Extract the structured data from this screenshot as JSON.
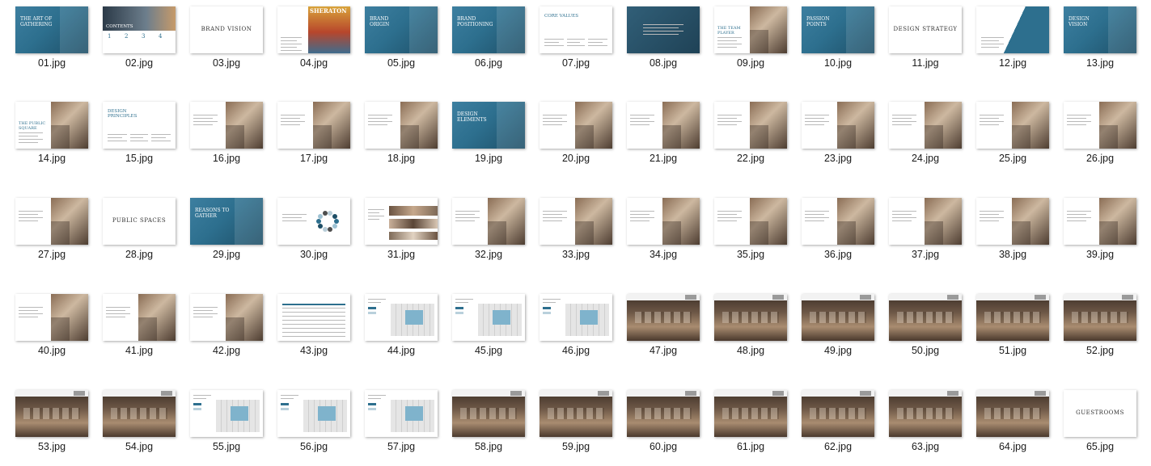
{
  "files": [
    {
      "name": "01.jpg",
      "style": "blue-img",
      "text": "THE ART OF GATHERING"
    },
    {
      "name": "02.jpg",
      "style": "contents",
      "text": "CONTENTS"
    },
    {
      "name": "03.jpg",
      "style": "title-white",
      "text": "BRAND VISION"
    },
    {
      "name": "04.jpg",
      "style": "sheraton",
      "text": "SHERATON"
    },
    {
      "name": "05.jpg",
      "style": "blue-img",
      "text": "BRAND ORIGIN"
    },
    {
      "name": "06.jpg",
      "style": "blue-img",
      "text": "BRAND POSITIONING"
    },
    {
      "name": "07.jpg",
      "style": "white-text",
      "text": "CORE VALUES"
    },
    {
      "name": "08.jpg",
      "style": "blue-dark",
      "text": ""
    },
    {
      "name": "09.jpg",
      "style": "text-photo",
      "text": "THE TEAM PLAYER"
    },
    {
      "name": "10.jpg",
      "style": "blue-img",
      "text": "PASSION POINTS"
    },
    {
      "name": "11.jpg",
      "style": "title-white",
      "text": "DESIGN STRATEGY"
    },
    {
      "name": "12.jpg",
      "style": "white-wedge",
      "text": ""
    },
    {
      "name": "13.jpg",
      "style": "blue-img",
      "text": "DESIGN VISION"
    },
    {
      "name": "14.jpg",
      "style": "text-photo",
      "text": "THE PUBLIC SQUARE"
    },
    {
      "name": "15.jpg",
      "style": "white-text",
      "text": "DESIGN PRINCIPLES"
    },
    {
      "name": "16.jpg",
      "style": "text-photo",
      "text": ""
    },
    {
      "name": "17.jpg",
      "style": "text-photo",
      "text": ""
    },
    {
      "name": "18.jpg",
      "style": "text-photo",
      "text": ""
    },
    {
      "name": "19.jpg",
      "style": "blue-img",
      "text": "DESIGN ELEMENTS"
    },
    {
      "name": "20.jpg",
      "style": "text-photo",
      "text": ""
    },
    {
      "name": "21.jpg",
      "style": "text-photo",
      "text": ""
    },
    {
      "name": "22.jpg",
      "style": "text-photo",
      "text": ""
    },
    {
      "name": "23.jpg",
      "style": "text-photo",
      "text": ""
    },
    {
      "name": "24.jpg",
      "style": "text-photo",
      "text": ""
    },
    {
      "name": "25.jpg",
      "style": "text-photo",
      "text": ""
    },
    {
      "name": "26.jpg",
      "style": "text-photo",
      "text": ""
    },
    {
      "name": "27.jpg",
      "style": "text-photo",
      "text": ""
    },
    {
      "name": "28.jpg",
      "style": "title-white",
      "text": "PUBLIC SPACES"
    },
    {
      "name": "29.jpg",
      "style": "blue-img",
      "text": "REASONS TO GATHER"
    },
    {
      "name": "30.jpg",
      "style": "dots",
      "text": ""
    },
    {
      "name": "31.jpg",
      "style": "wedge-strip",
      "text": ""
    },
    {
      "name": "32.jpg",
      "style": "text-photo",
      "text": ""
    },
    {
      "name": "33.jpg",
      "style": "text-photo",
      "text": ""
    },
    {
      "name": "34.jpg",
      "style": "text-photo",
      "text": ""
    },
    {
      "name": "35.jpg",
      "style": "text-photo",
      "text": ""
    },
    {
      "name": "36.jpg",
      "style": "text-photo",
      "text": ""
    },
    {
      "name": "37.jpg",
      "style": "text-photo",
      "text": ""
    },
    {
      "name": "38.jpg",
      "style": "text-photo",
      "text": ""
    },
    {
      "name": "39.jpg",
      "style": "text-photo",
      "text": ""
    },
    {
      "name": "40.jpg",
      "style": "text-photo",
      "text": ""
    },
    {
      "name": "41.jpg",
      "style": "text-photo",
      "text": ""
    },
    {
      "name": "42.jpg",
      "style": "text-photo",
      "text": ""
    },
    {
      "name": "43.jpg",
      "style": "table",
      "text": ""
    },
    {
      "name": "44.jpg",
      "style": "plan",
      "text": ""
    },
    {
      "name": "45.jpg",
      "style": "plan",
      "text": ""
    },
    {
      "name": "46.jpg",
      "style": "plan",
      "text": ""
    },
    {
      "name": "47.jpg",
      "style": "render",
      "text": ""
    },
    {
      "name": "48.jpg",
      "style": "render",
      "text": ""
    },
    {
      "name": "49.jpg",
      "style": "render",
      "text": ""
    },
    {
      "name": "50.jpg",
      "style": "render",
      "text": ""
    },
    {
      "name": "51.jpg",
      "style": "render",
      "text": ""
    },
    {
      "name": "52.jpg",
      "style": "render",
      "text": ""
    },
    {
      "name": "53.jpg",
      "style": "render",
      "text": ""
    },
    {
      "name": "54.jpg",
      "style": "render",
      "text": ""
    },
    {
      "name": "55.jpg",
      "style": "plan",
      "text": ""
    },
    {
      "name": "56.jpg",
      "style": "plan",
      "text": ""
    },
    {
      "name": "57.jpg",
      "style": "plan",
      "text": ""
    },
    {
      "name": "58.jpg",
      "style": "render",
      "text": ""
    },
    {
      "name": "59.jpg",
      "style": "render",
      "text": ""
    },
    {
      "name": "60.jpg",
      "style": "render",
      "text": ""
    },
    {
      "name": "61.jpg",
      "style": "render",
      "text": ""
    },
    {
      "name": "62.jpg",
      "style": "render",
      "text": ""
    },
    {
      "name": "63.jpg",
      "style": "render",
      "text": ""
    },
    {
      "name": "64.jpg",
      "style": "render",
      "text": ""
    },
    {
      "name": "65.jpg",
      "style": "title-white",
      "text": "GUESTROOMS"
    }
  ],
  "colors": {
    "brand_blue": "#2d6f8e",
    "dark_wood": "#5a4536",
    "label": "#1a1a1a"
  }
}
